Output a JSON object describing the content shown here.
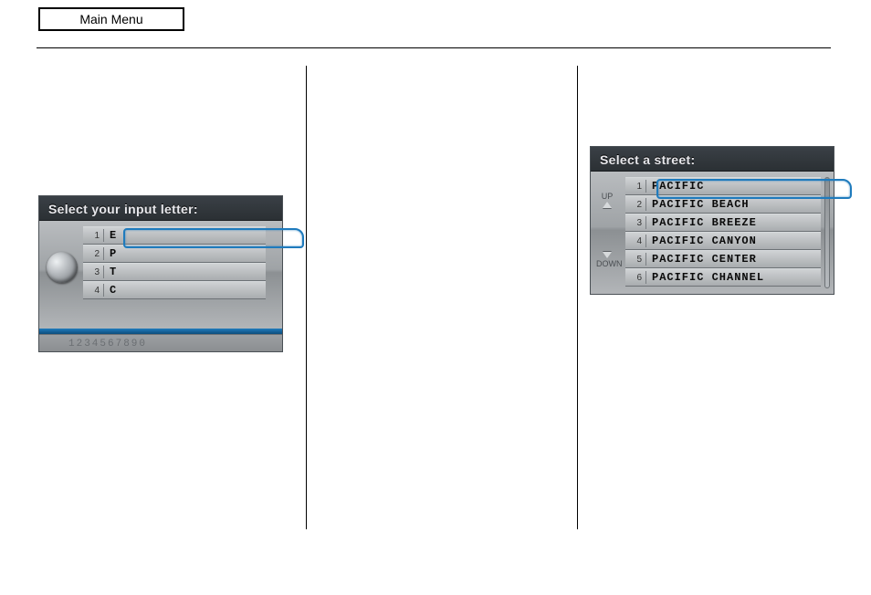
{
  "header": {
    "main_menu_label": "Main Menu"
  },
  "screen1": {
    "title": "Select your input letter:",
    "rows": [
      {
        "num": "1",
        "text": "E"
      },
      {
        "num": "2",
        "text": "P"
      },
      {
        "num": "3",
        "text": "T"
      },
      {
        "num": "4",
        "text": "C"
      }
    ],
    "footer_digits": "1234567890"
  },
  "screen2": {
    "title": "Select a street:",
    "up_label": "UP",
    "down_label": "DOWN",
    "rows": [
      {
        "num": "1",
        "text": "PACIFIC"
      },
      {
        "num": "2",
        "text": "PACIFIC BEACH"
      },
      {
        "num": "3",
        "text": "PACIFIC BREEZE"
      },
      {
        "num": "4",
        "text": "PACIFIC CANYON"
      },
      {
        "num": "5",
        "text": "PACIFIC CENTER"
      },
      {
        "num": "6",
        "text": "PACIFIC CHANNEL"
      }
    ]
  }
}
